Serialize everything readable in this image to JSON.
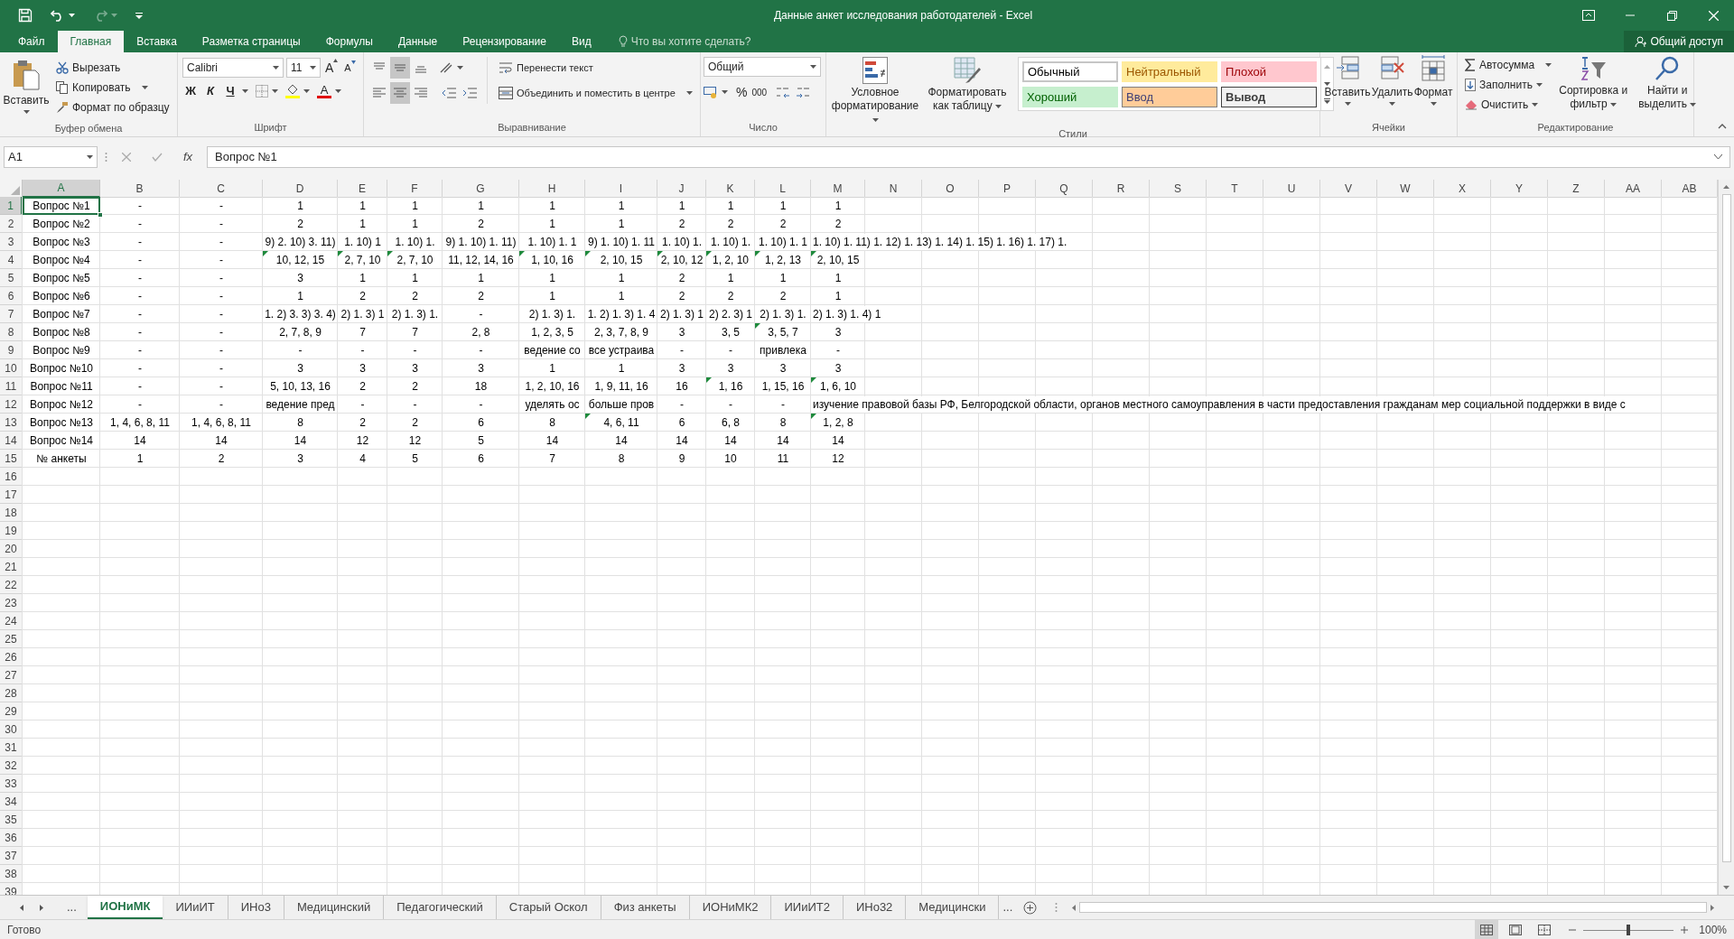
{
  "title_bar": {
    "title": "Данные анкет исследования работодателей - Excel"
  },
  "ribbon_tabs": [
    {
      "label": "Файл",
      "selected": false
    },
    {
      "label": "Главная",
      "selected": true
    },
    {
      "label": "Вставка",
      "selected": false
    },
    {
      "label": "Разметка страницы",
      "selected": false
    },
    {
      "label": "Формулы",
      "selected": false
    },
    {
      "label": "Данные",
      "selected": false
    },
    {
      "label": "Рецензирование",
      "selected": false
    },
    {
      "label": "Вид",
      "selected": false
    }
  ],
  "tell_me": {
    "placeholder": "Что вы хотите сделать?"
  },
  "share": "Общий доступ",
  "clipboard": {
    "label": "Буфер обмена",
    "paste": "Вставить",
    "cut": "Вырезать",
    "copy": "Копировать",
    "format_painter": "Формат по образцу"
  },
  "font": {
    "label": "Шрифт",
    "font_name": "Calibri",
    "font_size": "11",
    "grow": "A",
    "shrink": "A",
    "bold": "Ж",
    "italic": "К",
    "underline": "Ч",
    "font_color": "A"
  },
  "alignment": {
    "label": "Выравнивание",
    "vertical": [
      {
        "selected": false
      },
      {
        "selected": true
      },
      {
        "selected": false
      }
    ],
    "horizontal": [
      {
        "selected": false
      },
      {
        "selected": true
      },
      {
        "selected": false
      }
    ],
    "wrap_text": "Перенести текст",
    "merge": "Объединить и поместить в центре"
  },
  "number": {
    "label": "Число",
    "format": "Общий",
    "percent": "%",
    "thousands": "000"
  },
  "styles": {
    "label": "Стили",
    "conditional": "Условное форматирование",
    "format_table": "Форматировать как таблицу",
    "gallery": [
      {
        "name": "Обычный",
        "color": "#ffffff"
      },
      {
        "name": "Нейтральный",
        "color": "#ffeb9c"
      },
      {
        "name": "Плохой",
        "color": "#ffc7ce"
      },
      {
        "name": "Хороший",
        "color": "#c6efce"
      },
      {
        "name": "Ввод",
        "color": "#ffcc99"
      },
      {
        "name": "Вывод",
        "color": "#f2f2f2"
      }
    ]
  },
  "cells_group": {
    "label": "Ячейки",
    "insert": "Вставить",
    "delete": "Удалить",
    "format": "Формат"
  },
  "editing": {
    "label": "Редактирование",
    "autosum": "Автосумма",
    "fill": "Заполнить",
    "clear": "Очистить",
    "sort_filter": "Сортировка и фильтр",
    "find_select": "Найти и выделить"
  },
  "formula_bar": {
    "name_box": "A1",
    "fx": "fx",
    "content": "Вопрос №1"
  },
  "sheet": {
    "columns": [
      {
        "label": "A",
        "selected": true
      },
      {
        "label": "B",
        "selected": false
      },
      {
        "label": "C",
        "selected": false
      },
      {
        "label": "D",
        "selected": false
      },
      {
        "label": "E",
        "selected": false
      },
      {
        "label": "F",
        "selected": false
      },
      {
        "label": "G",
        "selected": false
      },
      {
        "label": "H",
        "selected": false
      },
      {
        "label": "I",
        "selected": false
      },
      {
        "label": "J",
        "selected": false
      },
      {
        "label": "K",
        "selected": false
      },
      {
        "label": "L",
        "selected": false
      },
      {
        "label": "M",
        "selected": false
      },
      {
        "label": "N",
        "selected": false
      },
      {
        "label": "O",
        "selected": false
      },
      {
        "label": "P",
        "selected": false
      },
      {
        "label": "Q",
        "selected": false
      },
      {
        "label": "R",
        "selected": false
      },
      {
        "label": "S",
        "selected": false
      },
      {
        "label": "T",
        "selected": false
      },
      {
        "label": "U",
        "selected": false
      },
      {
        "label": "V",
        "selected": false
      },
      {
        "label": "W",
        "selected": false
      },
      {
        "label": "X",
        "selected": false
      },
      {
        "label": "Y",
        "selected": false
      },
      {
        "label": "Z",
        "selected": false
      },
      {
        "label": "AA",
        "selected": false
      },
      {
        "label": "AB",
        "selected": false
      }
    ],
    "rows": [
      {
        "number": "1",
        "selected": true,
        "cells": [
          {
            "text": "Вопрос №1",
            "flag": false
          },
          {
            "text": "-",
            "flag": false
          },
          {
            "text": "-",
            "flag": false
          },
          {
            "text": "1",
            "flag": false
          },
          {
            "text": "1",
            "flag": false
          },
          {
            "text": "1",
            "flag": false
          },
          {
            "text": "1",
            "flag": false
          },
          {
            "text": "1",
            "flag": false
          },
          {
            "text": "1",
            "flag": false
          },
          {
            "text": "1",
            "flag": false
          },
          {
            "text": "1",
            "flag": false
          },
          {
            "text": "1",
            "flag": false
          },
          {
            "text": "1",
            "flag": false
          }
        ]
      },
      {
        "number": "2",
        "selected": false,
        "cells": [
          {
            "text": "Вопрос №2",
            "flag": false
          },
          {
            "text": "-",
            "flag": false
          },
          {
            "text": "-",
            "flag": false
          },
          {
            "text": "2",
            "flag": false
          },
          {
            "text": "1",
            "flag": false
          },
          {
            "text": "1",
            "flag": false
          },
          {
            "text": "2",
            "flag": false
          },
          {
            "text": "1",
            "flag": false
          },
          {
            "text": "1",
            "flag": false
          },
          {
            "text": "2",
            "flag": false
          },
          {
            "text": "2",
            "flag": false
          },
          {
            "text": "2",
            "flag": false
          },
          {
            "text": "2",
            "flag": false
          }
        ]
      },
      {
        "number": "3",
        "selected": false,
        "cells": [
          {
            "text": "Вопрос №3",
            "flag": false
          },
          {
            "text": "-",
            "flag": false
          },
          {
            "text": "-",
            "flag": false
          },
          {
            "text": "9) 2. 10) 3. 11)",
            "flag": false
          },
          {
            "text": "1. 10) 1",
            "flag": false
          },
          {
            "text": "1. 10) 1.",
            "flag": false
          },
          {
            "text": "9) 1. 10) 1. 11)",
            "flag": false
          },
          {
            "text": "1. 10) 1. 1",
            "flag": false
          },
          {
            "text": "9) 1. 10) 1. 11",
            "flag": false
          },
          {
            "text": "1. 10) 1.",
            "flag": false
          },
          {
            "text": "1. 10) 1.",
            "flag": false
          },
          {
            "text": "1. 10) 1. 1",
            "flag": false
          },
          {
            "text": "1. 10) 1. 11) 1. 12) 1. 13) 1. 14) 1. 15) 1. 16) 1. 17) 1.",
            "flag": false
          }
        ]
      },
      {
        "number": "4",
        "selected": false,
        "cells": [
          {
            "text": "Вопрос №4",
            "flag": false
          },
          {
            "text": "-",
            "flag": false
          },
          {
            "text": "-",
            "flag": false
          },
          {
            "text": "10, 12, 15",
            "flag": true
          },
          {
            "text": "2, 7, 10",
            "flag": true
          },
          {
            "text": "2, 7, 10",
            "flag": true
          },
          {
            "text": "11, 12, 14, 16",
            "flag": false
          },
          {
            "text": "1, 10, 16",
            "flag": true
          },
          {
            "text": "2, 10, 15",
            "flag": true
          },
          {
            "text": "2, 10, 12",
            "flag": true
          },
          {
            "text": "1, 2, 10",
            "flag": true
          },
          {
            "text": "1, 2, 13",
            "flag": true
          },
          {
            "text": "2, 10, 15",
            "flag": true
          }
        ]
      },
      {
        "number": "5",
        "selected": false,
        "cells": [
          {
            "text": "Вопрос №5",
            "flag": false
          },
          {
            "text": "-",
            "flag": false
          },
          {
            "text": "-",
            "flag": false
          },
          {
            "text": "3",
            "flag": false
          },
          {
            "text": "1",
            "flag": false
          },
          {
            "text": "1",
            "flag": false
          },
          {
            "text": "1",
            "flag": false
          },
          {
            "text": "1",
            "flag": false
          },
          {
            "text": "1",
            "flag": false
          },
          {
            "text": "2",
            "flag": false
          },
          {
            "text": "1",
            "flag": false
          },
          {
            "text": "1",
            "flag": false
          },
          {
            "text": "1",
            "flag": false
          }
        ]
      },
      {
        "number": "6",
        "selected": false,
        "cells": [
          {
            "text": "Вопрос №6",
            "flag": false
          },
          {
            "text": "-",
            "flag": false
          },
          {
            "text": "-",
            "flag": false
          },
          {
            "text": "1",
            "flag": false
          },
          {
            "text": "2",
            "flag": false
          },
          {
            "text": "2",
            "flag": false
          },
          {
            "text": "2",
            "flag": false
          },
          {
            "text": "1",
            "flag": false
          },
          {
            "text": "1",
            "flag": false
          },
          {
            "text": "2",
            "flag": false
          },
          {
            "text": "2",
            "flag": false
          },
          {
            "text": "2",
            "flag": false
          },
          {
            "text": "1",
            "flag": false
          }
        ]
      },
      {
        "number": "7",
        "selected": false,
        "cells": [
          {
            "text": "Вопрос №7",
            "flag": false
          },
          {
            "text": "-",
            "flag": false
          },
          {
            "text": "-",
            "flag": false
          },
          {
            "text": "1. 2) 3. 3) 3. 4)",
            "flag": false
          },
          {
            "text": "2) 1. 3) 1",
            "flag": false
          },
          {
            "text": "2) 1. 3) 1.",
            "flag": false
          },
          {
            "text": "-",
            "flag": false
          },
          {
            "text": "2) 1. 3) 1.",
            "flag": false
          },
          {
            "text": "1. 2) 1. 3) 1. 4",
            "flag": false
          },
          {
            "text": "2) 1. 3) 1",
            "flag": false
          },
          {
            "text": "2) 2. 3) 1",
            "flag": false
          },
          {
            "text": "2) 1. 3) 1.",
            "flag": false
          },
          {
            "text": "2) 1. 3) 1. 4) 1",
            "flag": false
          }
        ]
      },
      {
        "number": "8",
        "selected": false,
        "cells": [
          {
            "text": "Вопрос №8",
            "flag": false
          },
          {
            "text": "-",
            "flag": false
          },
          {
            "text": "-",
            "flag": false
          },
          {
            "text": "2, 7, 8, 9",
            "flag": false
          },
          {
            "text": "7",
            "flag": false
          },
          {
            "text": "7",
            "flag": false
          },
          {
            "text": "2, 8",
            "flag": false
          },
          {
            "text": "1, 2, 3, 5",
            "flag": false
          },
          {
            "text": "2, 3, 7, 8, 9",
            "flag": false
          },
          {
            "text": "3",
            "flag": false
          },
          {
            "text": "3, 5",
            "flag": false
          },
          {
            "text": "3, 5, 7",
            "flag": true
          },
          {
            "text": "3",
            "flag": false
          }
        ]
      },
      {
        "number": "9",
        "selected": false,
        "cells": [
          {
            "text": "Вопрос №9",
            "flag": false
          },
          {
            "text": "-",
            "flag": false
          },
          {
            "text": "-",
            "flag": false
          },
          {
            "text": "-",
            "flag": false
          },
          {
            "text": "-",
            "flag": false
          },
          {
            "text": "-",
            "flag": false
          },
          {
            "text": "-",
            "flag": false
          },
          {
            "text": "ведение со",
            "flag": false
          },
          {
            "text": "все устраива",
            "flag": false
          },
          {
            "text": "-",
            "flag": false
          },
          {
            "text": "-",
            "flag": false
          },
          {
            "text": "привлека",
            "flag": false
          },
          {
            "text": "-",
            "flag": false
          }
        ]
      },
      {
        "number": "10",
        "selected": false,
        "cells": [
          {
            "text": "Вопрос №10",
            "flag": false
          },
          {
            "text": "-",
            "flag": false
          },
          {
            "text": "-",
            "flag": false
          },
          {
            "text": "3",
            "flag": false
          },
          {
            "text": "3",
            "flag": false
          },
          {
            "text": "3",
            "flag": false
          },
          {
            "text": "3",
            "flag": false
          },
          {
            "text": "1",
            "flag": false
          },
          {
            "text": "1",
            "flag": false
          },
          {
            "text": "3",
            "flag": false
          },
          {
            "text": "3",
            "flag": false
          },
          {
            "text": "3",
            "flag": false
          },
          {
            "text": "3",
            "flag": false
          }
        ]
      },
      {
        "number": "11",
        "selected": false,
        "cells": [
          {
            "text": "Вопрос №11",
            "flag": false
          },
          {
            "text": "-",
            "flag": false
          },
          {
            "text": "-",
            "flag": false
          },
          {
            "text": "5, 10, 13, 16",
            "flag": false
          },
          {
            "text": "2",
            "flag": false
          },
          {
            "text": "2",
            "flag": false
          },
          {
            "text": "18",
            "flag": false
          },
          {
            "text": "1, 2, 10, 16",
            "flag": false
          },
          {
            "text": "1, 9, 11, 16",
            "flag": false
          },
          {
            "text": "16",
            "flag": false
          },
          {
            "text": "1, 16",
            "flag": true
          },
          {
            "text": "1, 15, 16",
            "flag": false
          },
          {
            "text": "1, 6, 10",
            "flag": true
          }
        ]
      },
      {
        "number": "12",
        "selected": false,
        "cells": [
          {
            "text": "Вопрос №12",
            "flag": false
          },
          {
            "text": "-",
            "flag": false
          },
          {
            "text": "-",
            "flag": false
          },
          {
            "text": "ведение пред",
            "flag": false
          },
          {
            "text": "-",
            "flag": false
          },
          {
            "text": "-",
            "flag": false
          },
          {
            "text": "-",
            "flag": false
          },
          {
            "text": "уделять ос",
            "flag": false
          },
          {
            "text": "больше пров",
            "flag": false
          },
          {
            "text": "-",
            "flag": false
          },
          {
            "text": "-",
            "flag": false
          },
          {
            "text": "-",
            "flag": false
          },
          {
            "text": "изучение правовой базы РФ, Белгородской области, органов местного самоуправления в части предоставления гражданам мер социальной поддержки в виде с",
            "flag": false
          }
        ]
      },
      {
        "number": "13",
        "selected": false,
        "cells": [
          {
            "text": "Вопрос №13",
            "flag": false
          },
          {
            "text": "1, 4, 6, 8, 11",
            "flag": false
          },
          {
            "text": "1, 4, 6, 8, 11",
            "flag": false
          },
          {
            "text": "8",
            "flag": false
          },
          {
            "text": "2",
            "flag": false
          },
          {
            "text": "2",
            "flag": false
          },
          {
            "text": "6",
            "flag": false
          },
          {
            "text": "8",
            "flag": false
          },
          {
            "text": "4, 6, 11",
            "flag": true
          },
          {
            "text": "6",
            "flag": false
          },
          {
            "text": "6, 8",
            "flag": false
          },
          {
            "text": "8",
            "flag": false
          },
          {
            "text": "1, 2, 8",
            "flag": true
          }
        ]
      },
      {
        "number": "14",
        "selected": false,
        "cells": [
          {
            "text": "Вопрос №14",
            "flag": false
          },
          {
            "text": "14",
            "flag": false
          },
          {
            "text": "14",
            "flag": false
          },
          {
            "text": "14",
            "flag": false
          },
          {
            "text": "12",
            "flag": false
          },
          {
            "text": "12",
            "flag": false
          },
          {
            "text": "5",
            "flag": false
          },
          {
            "text": "14",
            "flag": false
          },
          {
            "text": "14",
            "flag": false
          },
          {
            "text": "14",
            "flag": false
          },
          {
            "text": "14",
            "flag": false
          },
          {
            "text": "14",
            "flag": false
          },
          {
            "text": "14",
            "flag": false
          }
        ]
      },
      {
        "number": "15",
        "selected": false,
        "cells": [
          {
            "text": "№ анкеты",
            "flag": false
          },
          {
            "text": "1",
            "flag": false
          },
          {
            "text": "2",
            "flag": false
          },
          {
            "text": "3",
            "flag": false
          },
          {
            "text": "4",
            "flag": false
          },
          {
            "text": "5",
            "flag": false
          },
          {
            "text": "6",
            "flag": false
          },
          {
            "text": "7",
            "flag": false
          },
          {
            "text": "8",
            "flag": false
          },
          {
            "text": "9",
            "flag": false
          },
          {
            "text": "10",
            "flag": false
          },
          {
            "text": "11",
            "flag": false
          },
          {
            "text": "12",
            "flag": false
          }
        ]
      },
      {
        "number": "16",
        "selected": false
      },
      {
        "number": "17",
        "selected": false
      },
      {
        "number": "18",
        "selected": false
      },
      {
        "number": "19",
        "selected": false
      },
      {
        "number": "20",
        "selected": false
      },
      {
        "number": "21",
        "selected": false
      },
      {
        "number": "22",
        "selected": false
      },
      {
        "number": "23",
        "selected": false
      },
      {
        "number": "24",
        "selected": false
      },
      {
        "number": "25",
        "selected": false
      },
      {
        "number": "26",
        "selected": false
      },
      {
        "number": "27",
        "selected": false
      },
      {
        "number": "28",
        "selected": false
      },
      {
        "number": "29",
        "selected": false
      },
      {
        "number": "30",
        "selected": false
      },
      {
        "number": "31",
        "selected": false
      },
      {
        "number": "32",
        "selected": false
      },
      {
        "number": "33",
        "selected": false
      },
      {
        "number": "34",
        "selected": false
      },
      {
        "number": "35",
        "selected": false
      },
      {
        "number": "36",
        "selected": false
      },
      {
        "number": "37",
        "selected": false
      },
      {
        "number": "38",
        "selected": false
      },
      {
        "number": "39",
        "selected": false
      }
    ]
  },
  "sheet_tabs": {
    "more_left": "...",
    "tabs": [
      {
        "label": "ИОНиМК",
        "selected": true
      },
      {
        "label": "ИИиИТ",
        "selected": false
      },
      {
        "label": "ИНо3",
        "selected": false
      },
      {
        "label": "Медицинский",
        "selected": false
      },
      {
        "label": "Педагогический",
        "selected": false
      },
      {
        "label": "Старый Оскол",
        "selected": false
      },
      {
        "label": "Физ анкеты",
        "selected": false
      },
      {
        "label": "ИОНиМК2",
        "selected": false
      },
      {
        "label": "ИИиИТ2",
        "selected": false
      },
      {
        "label": "ИНо32",
        "selected": false
      },
      {
        "label": "Медицински",
        "selected": false
      }
    ],
    "more_right": "..."
  },
  "status_bar": {
    "status": "Готово",
    "views": [
      {
        "selected": true
      },
      {
        "selected": false
      },
      {
        "selected": false
      }
    ],
    "zoom": {
      "level": 0.5,
      "reading": "100%"
    }
  }
}
